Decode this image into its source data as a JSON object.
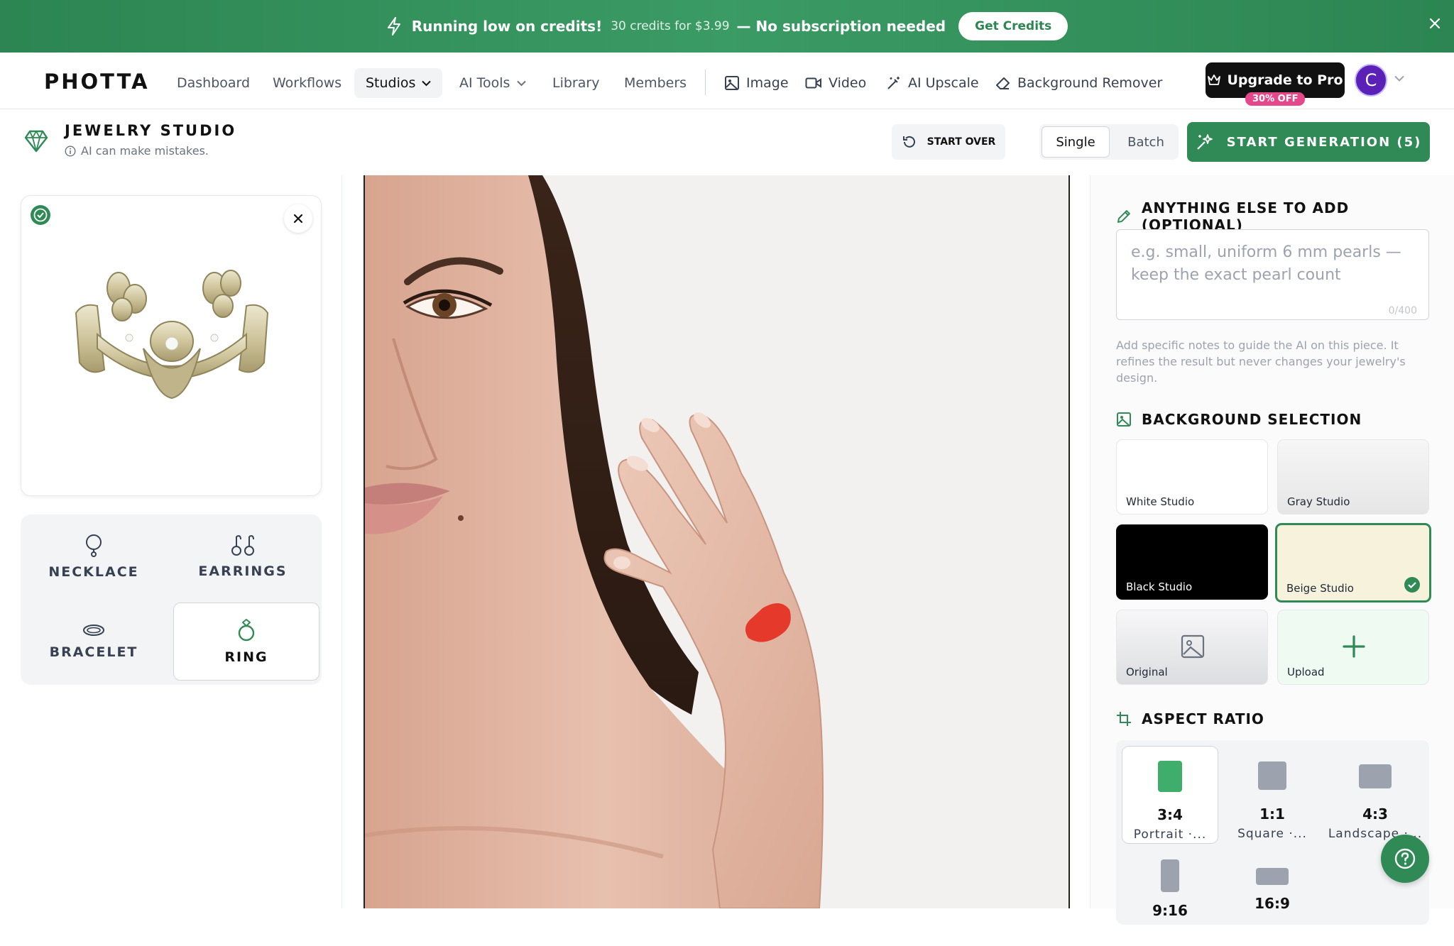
{
  "banner": {
    "headline": "Running low on credits!",
    "offer": "30 credits for $3.99",
    "tagline": "— No subscription needed",
    "cta": "Get Credits"
  },
  "nav": {
    "logo": "PHOTTA",
    "items": [
      "Dashboard",
      "Workflows",
      "Studios",
      "AI Tools",
      "Library",
      "Members"
    ],
    "tools": [
      "Image",
      "Video",
      "AI Upscale",
      "Background Remover"
    ],
    "upgrade": "Upgrade to Pro",
    "upgrade_badge": "30% OFF",
    "avatar_initial": "C"
  },
  "studio": {
    "title": "JEWELRY STUDIO",
    "disclaimer": "AI can make mistakes.",
    "start_over": "START OVER",
    "mode_single": "Single",
    "mode_batch": "Batch",
    "start_generation": "START GENERATION (5)"
  },
  "categories": [
    "NECKLACE",
    "EARRINGS",
    "BRACELET",
    "RING"
  ],
  "selected_category": "RING",
  "notes": {
    "heading": "ANYTHING ELSE TO ADD (OPTIONAL)",
    "placeholder": "e.g. small, uniform 6 mm pearls — keep the exact pearl count",
    "counter": "0/400",
    "help": "Add specific notes to guide the AI on this piece. It refines the result but never changes your jewelry's design."
  },
  "background": {
    "heading": "BACKGROUND SELECTION",
    "options": [
      "White Studio",
      "Gray Studio",
      "Black Studio",
      "Beige Studio",
      "Original",
      "Upload"
    ],
    "selected": "Beige Studio"
  },
  "aspect": {
    "heading": "ASPECT RATIO",
    "options": [
      {
        "ratio": "3:4",
        "name": "Portrait ·..."
      },
      {
        "ratio": "1:1",
        "name": "Square ·..."
      },
      {
        "ratio": "4:3",
        "name": "Landscape ·..."
      },
      {
        "ratio": "9:16",
        "name": ""
      },
      {
        "ratio": "16:9",
        "name": ""
      }
    ],
    "selected": "3:4"
  },
  "colors": {
    "brand_green": "#2f8a56",
    "banner_green": "#3b9b64",
    "pro_badge": "#e5488a",
    "avatar": "#5b21b6",
    "ring_marker": "#e5392b"
  }
}
